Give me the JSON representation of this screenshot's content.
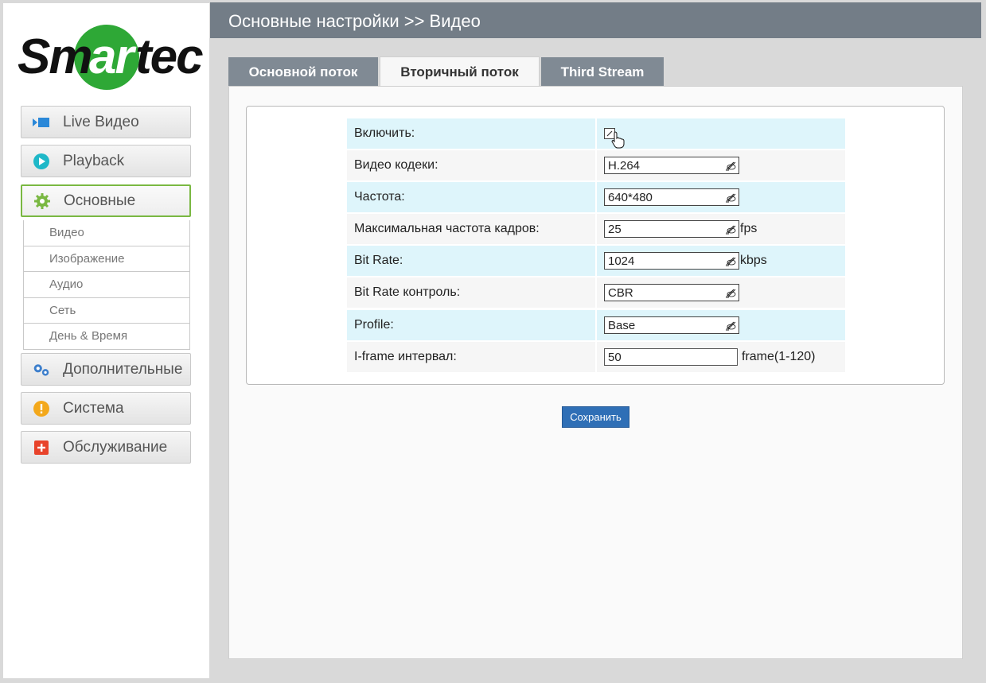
{
  "brand": {
    "logo_text": "Smartec",
    "logo_green": "#2ea836"
  },
  "sidebar": {
    "nav": [
      {
        "label": "Live Видео",
        "icon": "camera-icon"
      },
      {
        "label": "Playback",
        "icon": "play-icon"
      },
      {
        "label": "Основные",
        "icon": "gear-icon",
        "active": true
      },
      {
        "label": "Дополнительные",
        "icon": "gears-icon"
      },
      {
        "label": "Система",
        "icon": "warning-icon"
      },
      {
        "label": "Обслуживание",
        "icon": "plus-icon"
      }
    ],
    "submenu": [
      "Видео",
      "Изображение",
      "Аудио",
      "Сеть",
      "День & Время"
    ]
  },
  "header": {
    "title": "Основные настройки >> Видео"
  },
  "tabs": [
    {
      "label": "Основной поток",
      "active": false
    },
    {
      "label": "Вторичный поток",
      "active": true
    },
    {
      "label": "Third Stream",
      "active": false
    }
  ],
  "form": {
    "enable": {
      "label": "Включить:",
      "checked": false
    },
    "codec": {
      "label": "Видео кодеки:",
      "value": "H.264"
    },
    "resolution": {
      "label": "Частота:",
      "value": "640*480"
    },
    "max_fps": {
      "label": "Максимальная частота кадров:",
      "value": "25",
      "unit": "fps"
    },
    "bitrate": {
      "label": "Bit Rate:",
      "value": "1024",
      "unit": "kbps"
    },
    "bitrate_control": {
      "label": "Bit Rate контроль:",
      "value": "CBR"
    },
    "profile": {
      "label": "Profile:",
      "value": "Base"
    },
    "iframe": {
      "label": "I-frame интервал:",
      "value": "50",
      "unit": "frame(1-120)"
    }
  },
  "save_label": "Сохранить",
  "colors": {
    "header": "#737d87",
    "tab_inactive": "#808a94",
    "row_alt": "#def5fb",
    "save": "#2f6fb6",
    "active_border": "#7ab842"
  }
}
